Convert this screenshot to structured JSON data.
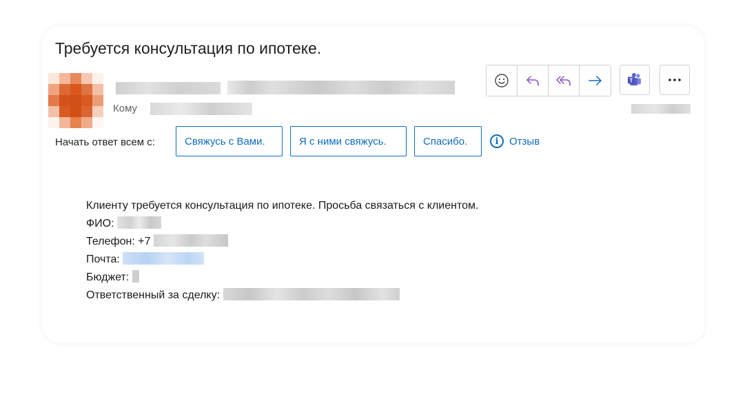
{
  "email": {
    "subject": "Требуется консультация по ипотеке.",
    "to_label": "Кому"
  },
  "actions": {
    "icons": [
      "emoji-icon",
      "reply-icon",
      "reply-all-icon",
      "forward-icon",
      "teams-icon",
      "more-icon"
    ]
  },
  "quick_replies": {
    "label": "Начать ответ всем с:",
    "options": [
      "Свяжусь с Вами.",
      "Я с ними свяжусь.",
      "Спасибо."
    ],
    "feedback_label": "Отзыв"
  },
  "body": {
    "intro": "Клиенту требуется консультация по ипотеке. Просьба связаться с клиентом.",
    "fio_label": "ФИО:",
    "phone_label": "Телефон: +7",
    "mail_label": "Почта:",
    "budget_label": "Бюджет:",
    "responsible_label": "Ответственный за сделку:"
  },
  "colors": {
    "accent": "#0f6cbd",
    "reply_purple": "#8a4fc9",
    "teams_purple": "#5b5fc7",
    "avatar_orange": "#d95a1f"
  }
}
